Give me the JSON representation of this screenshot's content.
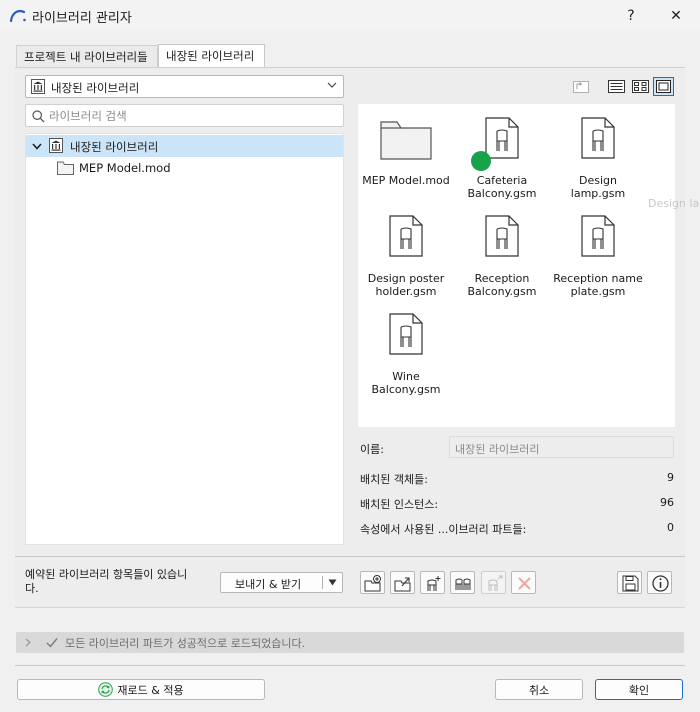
{
  "window": {
    "title": "라이브러리 관리자",
    "help": "?",
    "close": "✕"
  },
  "tabs": [
    {
      "label": "프로젝트 내 라이브러리들",
      "active": false
    },
    {
      "label": "내장된 라이브러리",
      "active": true
    }
  ],
  "library_dropdown": {
    "selected": "내장된 라이브러리"
  },
  "search": {
    "placeholder": "라이브러리 검색",
    "value": ""
  },
  "tree": {
    "root": {
      "label": "내장된 라이브러리",
      "expanded": true,
      "selected": true
    },
    "children": [
      {
        "label": "MEP Model.mod"
      }
    ]
  },
  "grid_items": [
    {
      "label_lines": [
        "MEP Model.mod"
      ],
      "type": "folder"
    },
    {
      "label_lines": [
        "Cafeteria",
        "Balcony.gsm"
      ],
      "type": "object"
    },
    {
      "label_lines": [
        "Design",
        "lamp.gsm"
      ],
      "type": "object"
    },
    {
      "label_lines": [
        "Design poster",
        "holder.gsm"
      ],
      "type": "object"
    },
    {
      "label_lines": [
        "Reception",
        "Balcony.gsm"
      ],
      "type": "object"
    },
    {
      "label_lines": [
        "Reception name",
        "plate.gsm"
      ],
      "type": "object"
    },
    {
      "label_lines": [
        "Wine",
        "Balcony.gsm"
      ],
      "type": "object"
    }
  ],
  "ghost_tooltip": "Design lar",
  "info": {
    "name_label": "이름:",
    "name_value": "내장된 라이브러리",
    "placed_objects_label": "배치된 객체들:",
    "placed_objects_value": "9",
    "placed_instances_label": "배치된 인스턴스:",
    "placed_instances_value": "96",
    "used_parts_label": "속성에서 사용된 ...이브러리 파트들:",
    "used_parts_value": "0"
  },
  "reserved": {
    "line1": "예약된 라이브러리 항목들이 있습니",
    "line2": "다."
  },
  "send_receive": {
    "label": "보내기 & 받기"
  },
  "status": {
    "text": "모든 라이브러리 파트가 성공적으로 로드되었습니다."
  },
  "buttons": {
    "reload": "재로드 & 적용",
    "cancel": "취소",
    "ok": "확인"
  },
  "colors": {
    "selection": "#cce4f7",
    "accent": "#1a6fc4",
    "green_dot": "#16a34a",
    "delete_x": "#e8a7a0"
  }
}
